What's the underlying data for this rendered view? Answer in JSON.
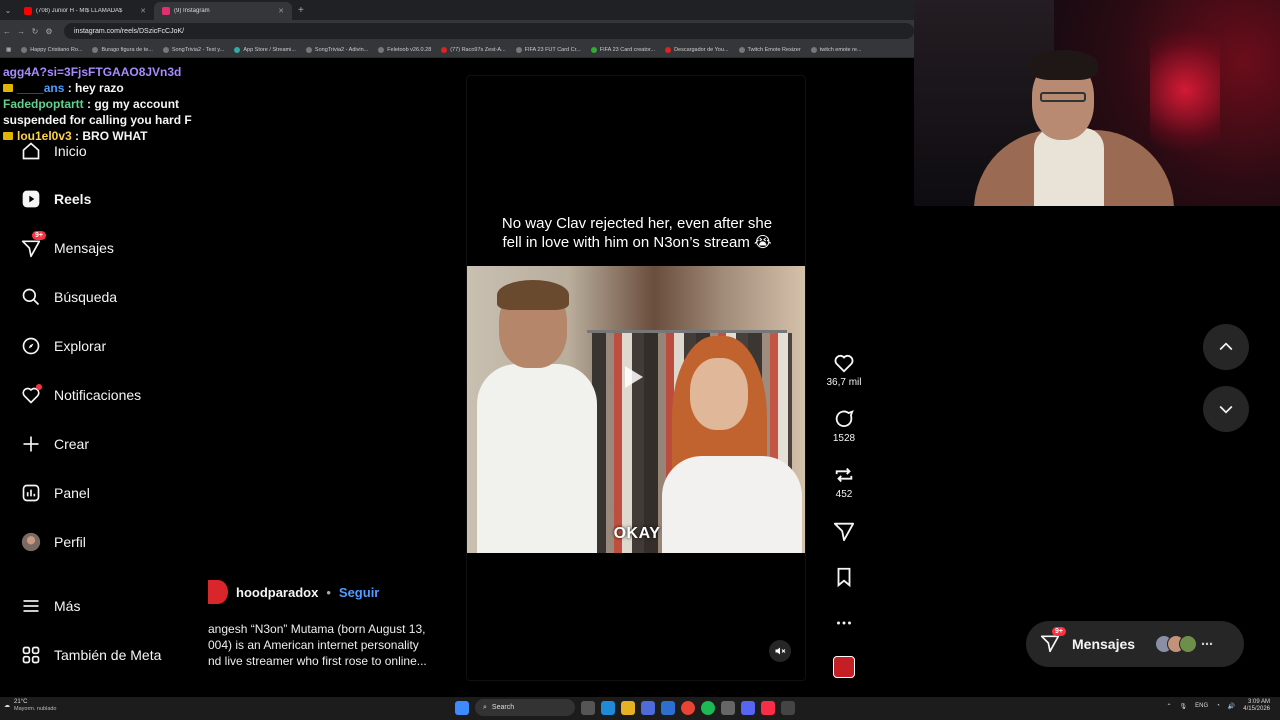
{
  "browser": {
    "tabs": [
      {
        "title": "(708) Junior H - MI$ LLAMADA$",
        "active": false,
        "color": "#ff0000"
      },
      {
        "title": "(9) Instagram",
        "active": true,
        "color": "#e1306c"
      }
    ],
    "url": "instagram.com/reels/DSzicFcCJoK/",
    "bookmarks": [
      "Happy Cristiano Ro...",
      "Burago figura de te...",
      "SongTrivia2 - Test y...",
      "App Store / Streami...",
      "SongTrivia2 - Adivin...",
      "Feletoob v26.0.28",
      "(77) Raco97s Zest-A...",
      "FIFA 23 FUT Card Cr...",
      "FIFA 23 Card creator...",
      "Descargador de You...",
      "Twitch Emote Resizer",
      "twitch emote re..."
    ]
  },
  "chat": [
    {
      "user": "",
      "text": "agg4A?si=3FjsFTGAAO8JVn3d",
      "user_color": "#a88bff"
    },
    {
      "user": "____ans",
      "text": ": hey razo",
      "user_color": "#4f9dff"
    },
    {
      "user": "Fadedpoptartt",
      "text": ": gg my account suspended for calling you hard F",
      "user_color": "#63d18c"
    },
    {
      "user": "lou1el0v3",
      "text": ": BRO WHAT",
      "user_color": "#ffd24a"
    }
  ],
  "sidebar": {
    "items": [
      {
        "label": "Inicio",
        "icon": "home-icon"
      },
      {
        "label": "Reels",
        "icon": "reels-icon",
        "active": true
      },
      {
        "label": "Mensajes",
        "icon": "messages-icon",
        "badge": "9+"
      },
      {
        "label": "Búsqueda",
        "icon": "search-icon"
      },
      {
        "label": "Explorar",
        "icon": "explore-icon"
      },
      {
        "label": "Notificaciones",
        "icon": "heart-icon",
        "dot": true
      },
      {
        "label": "Crear",
        "icon": "plus-icon"
      },
      {
        "label": "Panel",
        "icon": "dashboard-icon"
      },
      {
        "label": "Perfil",
        "icon": "profile-avatar"
      },
      {
        "label": "Más",
        "icon": "menu-icon"
      },
      {
        "label": "También de Meta",
        "icon": "meta-apps-icon"
      }
    ]
  },
  "reel": {
    "caption_line1": "No way Clav rejected her, even after she",
    "caption_line2": "fell in love with him on N3on’s stream 😭",
    "subtitle": "OKAY",
    "author": "hoodparadox",
    "separator": "•",
    "follow_label": "Seguir",
    "description_line1": "angesh “N3on” Mutama (born August 13,",
    "description_line2": "004) is an American internet personality",
    "description_line3": "nd live streamer who first rose to online..."
  },
  "actions": {
    "likes": "36,7 mil",
    "comments": "1528",
    "reposts": "452"
  },
  "messages_pill": {
    "label": "Mensajes",
    "badge": "9+"
  },
  "taskbar": {
    "temp": "21°C",
    "condition": "Mayorm. nublado",
    "search": "Search",
    "lang": "ENG",
    "time": "3:09 AM",
    "date": "4/15/2026"
  },
  "colors": {
    "background": "#000000",
    "accent_blue": "#4f9dff",
    "badge_red": "#ff3040",
    "panel": "#262626"
  }
}
